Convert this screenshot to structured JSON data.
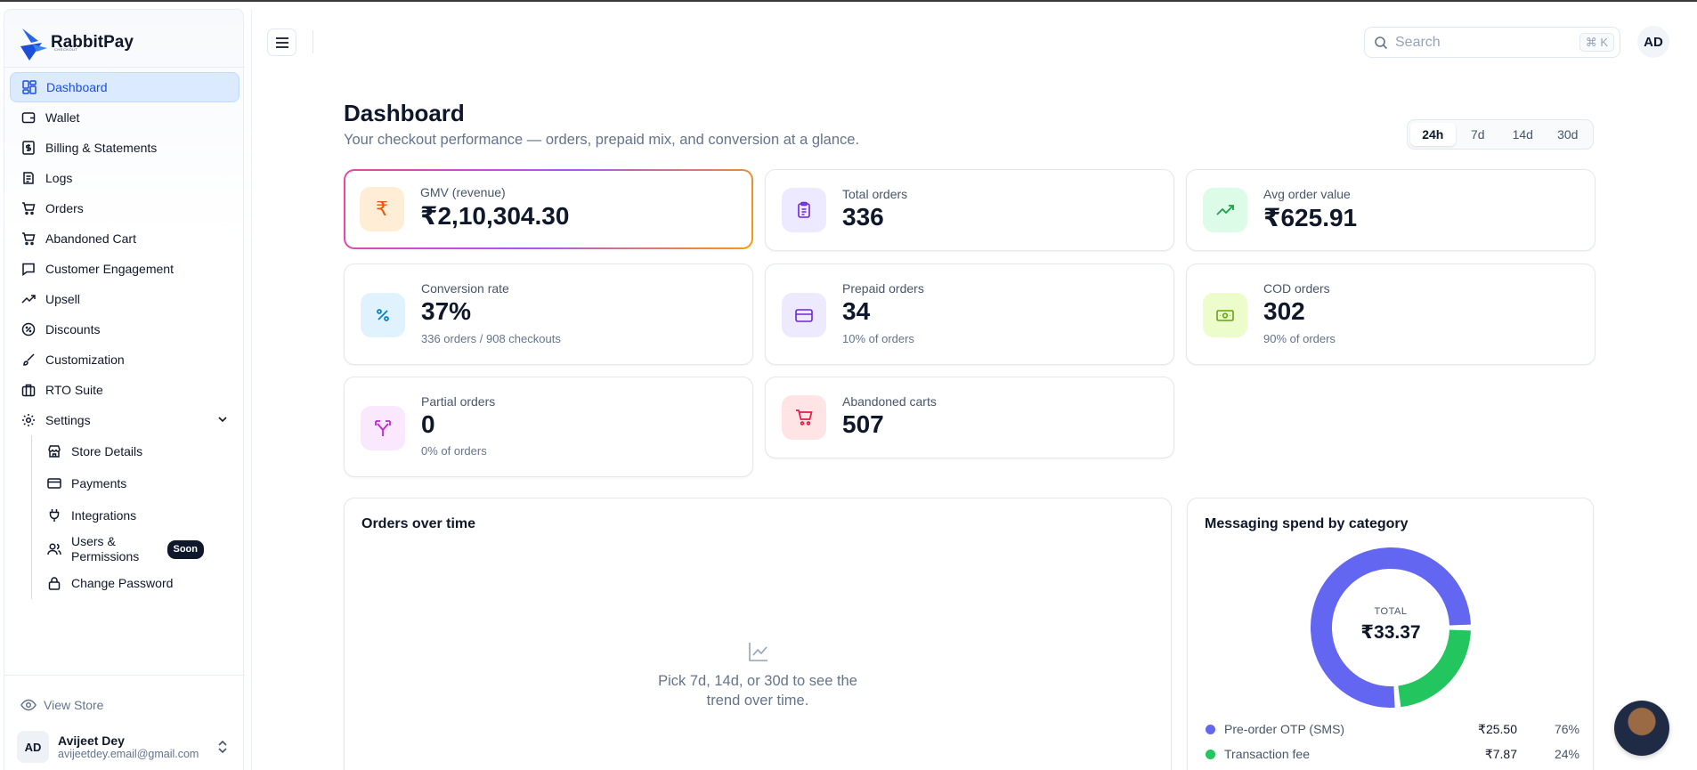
{
  "brand": {
    "name": "RabbitPay",
    "sub": "CHECKOUT"
  },
  "sidebar": {
    "items": [
      {
        "label": "Dashboard",
        "icon": "dashboard-icon"
      },
      {
        "label": "Wallet",
        "icon": "wallet-icon"
      },
      {
        "label": "Billing & Statements",
        "icon": "billing-icon"
      },
      {
        "label": "Logs",
        "icon": "logs-icon"
      },
      {
        "label": "Orders",
        "icon": "cart-icon"
      },
      {
        "label": "Abandoned Cart",
        "icon": "cart-icon"
      },
      {
        "label": "Customer Engagement",
        "icon": "chat-icon"
      },
      {
        "label": "Upsell",
        "icon": "trend-icon"
      },
      {
        "label": "Discounts",
        "icon": "discount-icon"
      },
      {
        "label": "Customization",
        "icon": "brush-icon"
      },
      {
        "label": "RTO Suite",
        "icon": "briefcase-icon"
      },
      {
        "label": "Settings",
        "icon": "gear-icon"
      }
    ],
    "settings_sub": [
      {
        "label": "Store Details"
      },
      {
        "label": "Payments"
      },
      {
        "label": "Integrations"
      },
      {
        "label": "Users & Permissions",
        "badge": "Soon"
      },
      {
        "label": "Change Password"
      }
    ],
    "view_store": "View Store",
    "user": {
      "initials": "AD",
      "name": "Avijeet Dey",
      "email": "avijeetdey.email@gmail.com"
    }
  },
  "header": {
    "search_placeholder": "Search",
    "search_shortcut": "⌘ K",
    "avatar_initials": "AD"
  },
  "page": {
    "title": "Dashboard",
    "subtitle": "Your checkout performance — orders, prepaid mix, and conversion at a glance.",
    "ranges": [
      "24h",
      "7d",
      "14d",
      "30d"
    ],
    "selected_range": "24h"
  },
  "stats": {
    "gmv": {
      "label": "GMV (revenue)",
      "value": "₹2,10,304.30"
    },
    "total_orders": {
      "label": "Total orders",
      "value": "336"
    },
    "aov": {
      "label": "Avg order value",
      "value": "₹625.91"
    },
    "conversion": {
      "label": "Conversion rate",
      "value": "37%",
      "note": "336 orders / 908 checkouts"
    },
    "prepaid": {
      "label": "Prepaid orders",
      "value": "34",
      "note": "10% of orders"
    },
    "cod": {
      "label": "COD orders",
      "value": "302",
      "note": "90% of orders"
    },
    "partial": {
      "label": "Partial orders",
      "value": "0",
      "note": "0% of orders"
    },
    "abandoned": {
      "label": "Abandoned carts",
      "value": "507"
    }
  },
  "orders_chart": {
    "title": "Orders over time",
    "empty_line1": "Pick 7d, 14d, or 30d to see the",
    "empty_line2": "trend over time."
  },
  "messaging": {
    "title": "Messaging spend by category",
    "total_label": "TOTAL",
    "total_value": "₹33.37",
    "colors": {
      "otp": "#6366f1",
      "fee": "#22c55e"
    }
  },
  "chart_data": {
    "type": "pie",
    "title": "Messaging spend by category",
    "categories": [
      "Pre-order OTP (SMS)",
      "Transaction fee"
    ],
    "values": [
      25.5,
      7.87
    ],
    "value_labels": [
      "₹25.50",
      "₹7.87"
    ],
    "percent_labels": [
      "76%",
      "24%"
    ]
  }
}
